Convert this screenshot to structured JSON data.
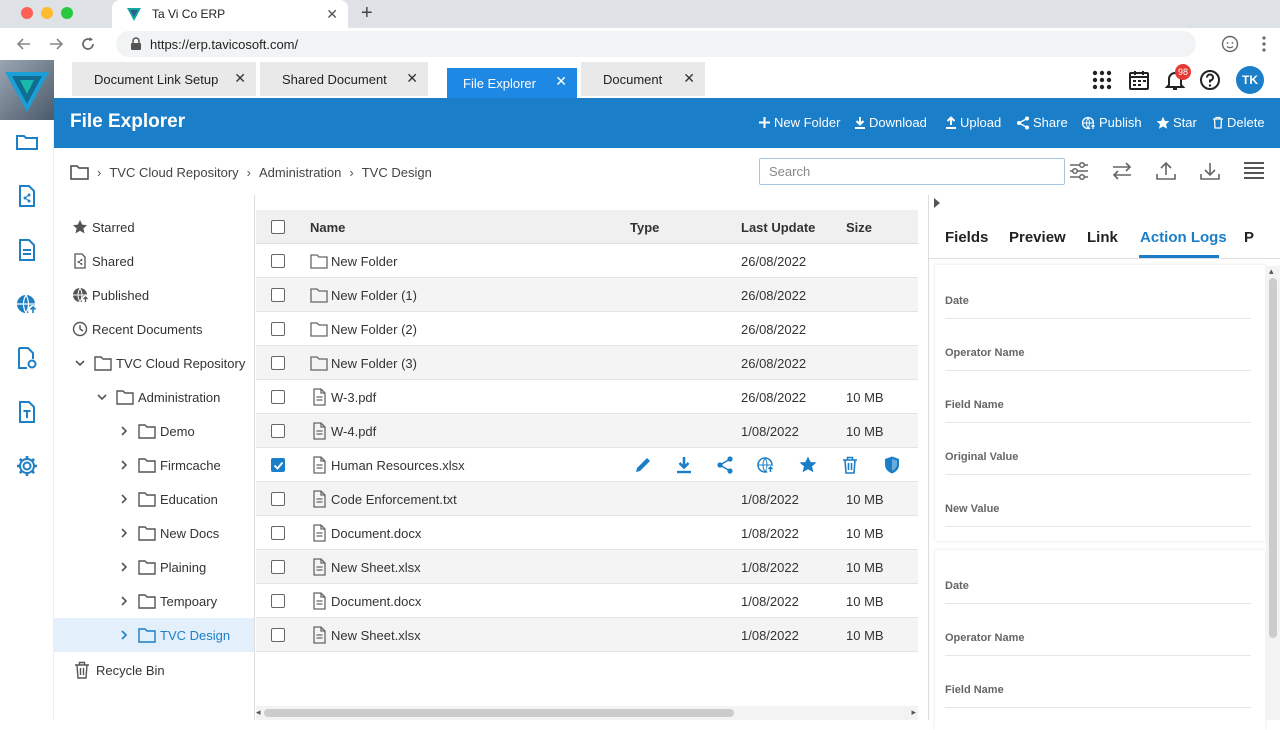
{
  "browser": {
    "tab_title": "Ta Vi Co ERP",
    "url": "https://erp.tavicosoft.com/"
  },
  "app_tabs": [
    {
      "label": "Document Link Setup"
    },
    {
      "label": "Shared Document"
    },
    {
      "label": "File Explorer"
    },
    {
      "label": "Document"
    }
  ],
  "topbar": {
    "notification_count": "98",
    "user_initials": "TK"
  },
  "header": {
    "title": "File Explorer",
    "actions": {
      "new_folder": "New Folder",
      "download": "Download",
      "upload": "Upload",
      "share": "Share",
      "publish": "Publish",
      "star": "Star",
      "delete": "Delete"
    }
  },
  "breadcrumb": [
    "TVC Cloud Repository",
    "Administration",
    "TVC Design"
  ],
  "search": {
    "placeholder": "Search",
    "value": ""
  },
  "sidebar": {
    "starred": "Starred",
    "shared": "Shared",
    "published": "Published",
    "recent": "Recent Documents",
    "repo": "TVC Cloud Repository",
    "admin": "Administration",
    "folders": [
      "Demo",
      "Firmcache",
      "Education",
      "New Docs",
      "Plaining",
      "Tempoary",
      "TVC Design"
    ],
    "recycle": "Recycle Bin"
  },
  "table": {
    "columns": {
      "name": "Name",
      "type": "Type",
      "updated": "Last Update",
      "size": "Size"
    },
    "rows": [
      {
        "name": "New Folder",
        "updated": "26/08/2022",
        "size": ""
      },
      {
        "name": "New Folder (1)",
        "updated": "26/08/2022",
        "size": ""
      },
      {
        "name": "New Folder (2)",
        "updated": "26/08/2022",
        "size": ""
      },
      {
        "name": "New Folder (3)",
        "updated": "26/08/2022",
        "size": ""
      },
      {
        "name": "W-3.pdf",
        "updated": "26/08/2022",
        "size": "10 MB"
      },
      {
        "name": "W-4.pdf",
        "updated": "1/08/2022",
        "size": "10 MB"
      },
      {
        "name": "Human Resources.xlsx",
        "updated": "",
        "size": ""
      },
      {
        "name": "Code Enforcement.txt",
        "updated": "1/08/2022",
        "size": "10 MB"
      },
      {
        "name": "Document.docx",
        "updated": "1/08/2022",
        "size": "10 MB"
      },
      {
        "name": "New Sheet.xlsx",
        "updated": "1/08/2022",
        "size": "10 MB"
      },
      {
        "name": "Document.docx",
        "updated": "1/08/2022",
        "size": "10 MB"
      },
      {
        "name": "New Sheet.xlsx",
        "updated": "1/08/2022",
        "size": "10 MB"
      }
    ]
  },
  "panel": {
    "tabs": [
      "Fields",
      "Preview",
      "Link",
      "Action Logs",
      "P"
    ],
    "fields": {
      "date": "Date",
      "operator": "Operator Name",
      "field_name": "Field Name",
      "original": "Original Value",
      "new_value": "New Value"
    }
  },
  "colors": {
    "accent": "#1b7ec8",
    "notification": "#e53935"
  }
}
